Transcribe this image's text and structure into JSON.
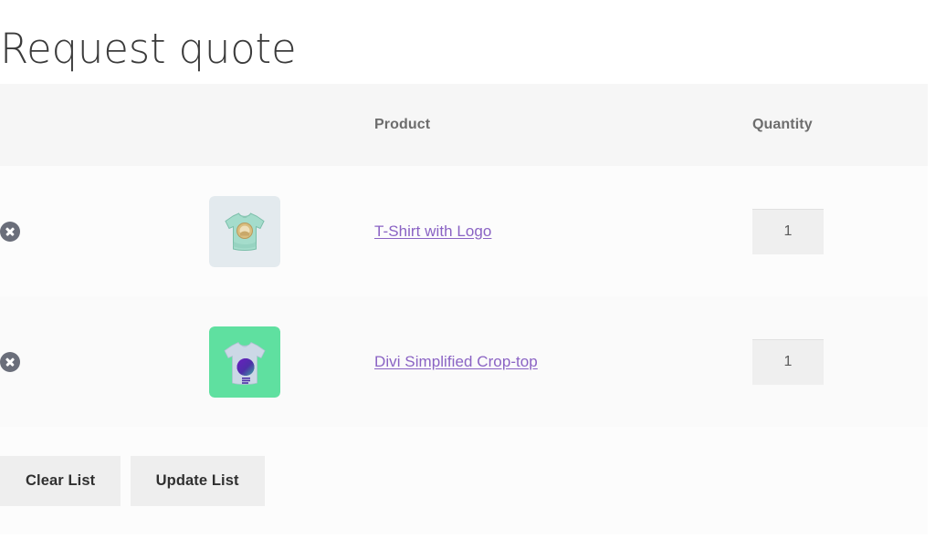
{
  "page": {
    "title": "Request quote"
  },
  "table": {
    "columns": {
      "remove": "",
      "thumbnail": "",
      "product": "Product",
      "quantity": "Quantity"
    },
    "rows": [
      {
        "remove_label": "Remove T-Shirt with Logo",
        "product_name": "T-Shirt with Logo",
        "quantity": "1",
        "thumbnail": {
          "name": "t-shirt-with-logo-thumbnail",
          "background_color": "#e3eaee",
          "shirt_color": "#a4dccb",
          "shirt_shadow_color": "#8cc9b6",
          "logo_color": "#d9bd7e"
        }
      },
      {
        "remove_label": "Remove Divi Simplified Crop-top",
        "product_name": "Divi Simplified Crop-top",
        "quantity": "1",
        "thumbnail": {
          "name": "divi-simplified-crop-top-thumbnail",
          "background_color": "#5fe0a0",
          "shirt_color": "#ccd8e6",
          "shirt_shadow_color": "#b6c5d8",
          "logo_color": "#5b1fb0",
          "logo_color_2": "#3aa8a0"
        }
      }
    ]
  },
  "actions": {
    "clear_list_label": "Clear List",
    "update_list_label": "Update List"
  },
  "colors": {
    "link": "#8a63c4",
    "header_text": "#6d6d6d",
    "header_bg": "#f6f6f6",
    "row_bg": "#fcfcfc",
    "button_bg": "#eeeeee",
    "remove_icon": "#6a6e7a"
  }
}
